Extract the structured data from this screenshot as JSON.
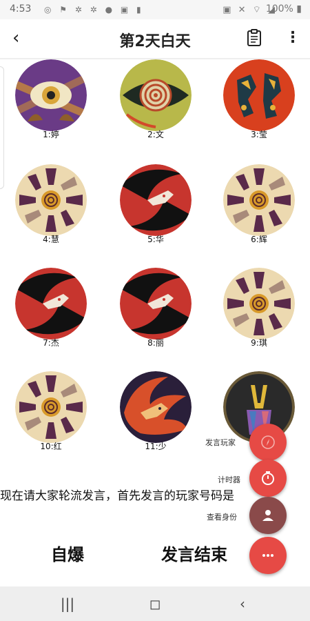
{
  "status_bar": {
    "time": "4:53",
    "battery": "100%"
  },
  "app_bar": {
    "title": "第2天白天"
  },
  "players": [
    {
      "label": "1:婷",
      "art": "eye"
    },
    {
      "label": "2:文",
      "art": "spiral-eye"
    },
    {
      "label": "3:莹",
      "art": "red-figures"
    },
    {
      "label": "4:慧",
      "art": "villager"
    },
    {
      "label": "5:华",
      "art": "werewolf"
    },
    {
      "label": "6:辉",
      "art": "villager"
    },
    {
      "label": "7:杰",
      "art": "werewolf"
    },
    {
      "label": "8:丽",
      "art": "werewolf"
    },
    {
      "label": "9:琪",
      "art": "villager"
    },
    {
      "label": "10:红",
      "art": "villager"
    },
    {
      "label": "11:少",
      "art": "fire-wolf"
    },
    {
      "label": "",
      "art": "hands"
    }
  ],
  "fab_menu": {
    "speaker_label": "发言玩家",
    "timer_label": "计时器",
    "identity_label": "查看身份"
  },
  "announcement": "现在请大家轮流发言，首先发言的玩家号码是",
  "actions": {
    "self_destruct": "自爆",
    "end_speech": "发言结束"
  },
  "colors": {
    "fab": "#e64a45",
    "fab_identity": "#8a4a4a"
  }
}
